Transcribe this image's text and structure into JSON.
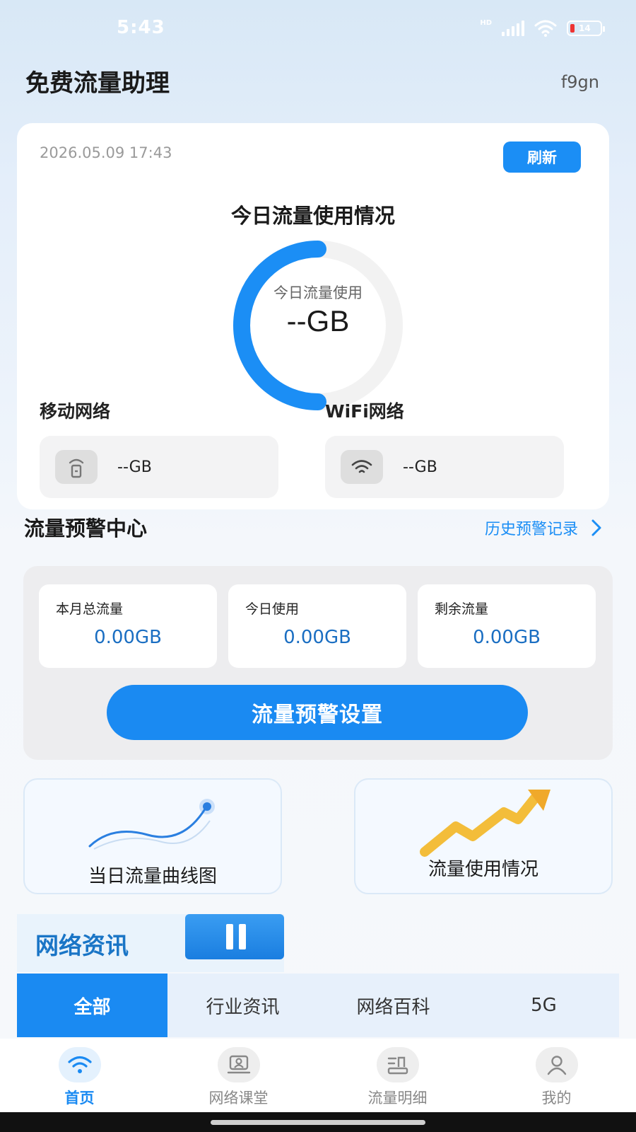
{
  "status_bar": {
    "time": "5:43",
    "network_type": "HD",
    "battery_level": "14",
    "icons": [
      "signal-icon",
      "wifi-icon",
      "battery-icon"
    ]
  },
  "header": {
    "title": "免费流量助理",
    "user_id": "f9gn"
  },
  "usage_card": {
    "date": "2026.05.09 17:43",
    "refresh_label": "刷新",
    "title": "今日流量使用情况",
    "gauge": {
      "label": "今日流量使用",
      "value": "--GB",
      "fill_fraction": 0.5,
      "color": "#1b8ef5"
    },
    "mobile": {
      "label": "移动网络",
      "value": "--GB",
      "icon": "mobile-network-icon"
    },
    "wifi": {
      "label": "WiFi网络",
      "value": "--GB",
      "icon": "wifi-icon"
    }
  },
  "warning": {
    "title": "流量预警中心",
    "history_link": "历史预警记录",
    "stats": [
      {
        "label": "本月总流量",
        "value": "0.00GB"
      },
      {
        "label": "今日使用",
        "value": "0.00GB"
      },
      {
        "label": "剩余流量",
        "value": "0.00GB"
      }
    ],
    "settings_button": "流量预警设置"
  },
  "features": [
    {
      "title": "当日流量曲线图",
      "icon": "curve-chart-icon"
    },
    {
      "title": "流量使用情况",
      "icon": "rising-arrow-icon"
    }
  ],
  "news": {
    "title": "网络资讯",
    "tabs": [
      "全部",
      "行业资讯",
      "网络百科",
      "5G"
    ],
    "active_tab": 0
  },
  "bottom_nav": {
    "items": [
      {
        "label": "首页",
        "icon": "wifi-home-icon"
      },
      {
        "label": "网络课堂",
        "icon": "classroom-icon"
      },
      {
        "label": "流量明细",
        "icon": "detail-icon"
      },
      {
        "label": "我的",
        "icon": "user-icon"
      }
    ],
    "active": 0
  },
  "colors": {
    "accent": "#1b8ef5",
    "stat_value": "#1a6ec2",
    "news_title": "#1a75c6"
  }
}
